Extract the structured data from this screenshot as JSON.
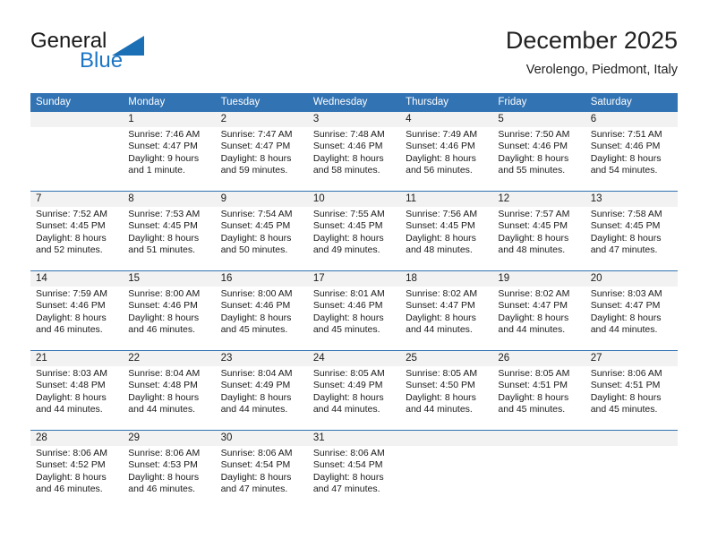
{
  "brand": {
    "word1": "General",
    "word2": "Blue",
    "triangle_color": "#1a6fb5",
    "blue_text_color": "#1c76c5"
  },
  "header": {
    "month_title": "December 2025",
    "location": "Verolengo, Piedmont, Italy"
  },
  "theme": {
    "header_blue": "#3273b3",
    "day_band_gray": "#f2f2f2",
    "text_color": "#1a1a1a"
  },
  "calendar": {
    "weekdays": [
      "Sunday",
      "Monday",
      "Tuesday",
      "Wednesday",
      "Thursday",
      "Friday",
      "Saturday"
    ],
    "weeks": [
      [
        {
          "day": "",
          "lines": []
        },
        {
          "day": "1",
          "lines": [
            "Sunrise: 7:46 AM",
            "Sunset: 4:47 PM",
            "Daylight: 9 hours",
            "and 1 minute."
          ]
        },
        {
          "day": "2",
          "lines": [
            "Sunrise: 7:47 AM",
            "Sunset: 4:47 PM",
            "Daylight: 8 hours",
            "and 59 minutes."
          ]
        },
        {
          "day": "3",
          "lines": [
            "Sunrise: 7:48 AM",
            "Sunset: 4:46 PM",
            "Daylight: 8 hours",
            "and 58 minutes."
          ]
        },
        {
          "day": "4",
          "lines": [
            "Sunrise: 7:49 AM",
            "Sunset: 4:46 PM",
            "Daylight: 8 hours",
            "and 56 minutes."
          ]
        },
        {
          "day": "5",
          "lines": [
            "Sunrise: 7:50 AM",
            "Sunset: 4:46 PM",
            "Daylight: 8 hours",
            "and 55 minutes."
          ]
        },
        {
          "day": "6",
          "lines": [
            "Sunrise: 7:51 AM",
            "Sunset: 4:46 PM",
            "Daylight: 8 hours",
            "and 54 minutes."
          ]
        }
      ],
      [
        {
          "day": "7",
          "lines": [
            "Sunrise: 7:52 AM",
            "Sunset: 4:45 PM",
            "Daylight: 8 hours",
            "and 52 minutes."
          ]
        },
        {
          "day": "8",
          "lines": [
            "Sunrise: 7:53 AM",
            "Sunset: 4:45 PM",
            "Daylight: 8 hours",
            "and 51 minutes."
          ]
        },
        {
          "day": "9",
          "lines": [
            "Sunrise: 7:54 AM",
            "Sunset: 4:45 PM",
            "Daylight: 8 hours",
            "and 50 minutes."
          ]
        },
        {
          "day": "10",
          "lines": [
            "Sunrise: 7:55 AM",
            "Sunset: 4:45 PM",
            "Daylight: 8 hours",
            "and 49 minutes."
          ]
        },
        {
          "day": "11",
          "lines": [
            "Sunrise: 7:56 AM",
            "Sunset: 4:45 PM",
            "Daylight: 8 hours",
            "and 48 minutes."
          ]
        },
        {
          "day": "12",
          "lines": [
            "Sunrise: 7:57 AM",
            "Sunset: 4:45 PM",
            "Daylight: 8 hours",
            "and 48 minutes."
          ]
        },
        {
          "day": "13",
          "lines": [
            "Sunrise: 7:58 AM",
            "Sunset: 4:45 PM",
            "Daylight: 8 hours",
            "and 47 minutes."
          ]
        }
      ],
      [
        {
          "day": "14",
          "lines": [
            "Sunrise: 7:59 AM",
            "Sunset: 4:46 PM",
            "Daylight: 8 hours",
            "and 46 minutes."
          ]
        },
        {
          "day": "15",
          "lines": [
            "Sunrise: 8:00 AM",
            "Sunset: 4:46 PM",
            "Daylight: 8 hours",
            "and 46 minutes."
          ]
        },
        {
          "day": "16",
          "lines": [
            "Sunrise: 8:00 AM",
            "Sunset: 4:46 PM",
            "Daylight: 8 hours",
            "and 45 minutes."
          ]
        },
        {
          "day": "17",
          "lines": [
            "Sunrise: 8:01 AM",
            "Sunset: 4:46 PM",
            "Daylight: 8 hours",
            "and 45 minutes."
          ]
        },
        {
          "day": "18",
          "lines": [
            "Sunrise: 8:02 AM",
            "Sunset: 4:47 PM",
            "Daylight: 8 hours",
            "and 44 minutes."
          ]
        },
        {
          "day": "19",
          "lines": [
            "Sunrise: 8:02 AM",
            "Sunset: 4:47 PM",
            "Daylight: 8 hours",
            "and 44 minutes."
          ]
        },
        {
          "day": "20",
          "lines": [
            "Sunrise: 8:03 AM",
            "Sunset: 4:47 PM",
            "Daylight: 8 hours",
            "and 44 minutes."
          ]
        }
      ],
      [
        {
          "day": "21",
          "lines": [
            "Sunrise: 8:03 AM",
            "Sunset: 4:48 PM",
            "Daylight: 8 hours",
            "and 44 minutes."
          ]
        },
        {
          "day": "22",
          "lines": [
            "Sunrise: 8:04 AM",
            "Sunset: 4:48 PM",
            "Daylight: 8 hours",
            "and 44 minutes."
          ]
        },
        {
          "day": "23",
          "lines": [
            "Sunrise: 8:04 AM",
            "Sunset: 4:49 PM",
            "Daylight: 8 hours",
            "and 44 minutes."
          ]
        },
        {
          "day": "24",
          "lines": [
            "Sunrise: 8:05 AM",
            "Sunset: 4:49 PM",
            "Daylight: 8 hours",
            "and 44 minutes."
          ]
        },
        {
          "day": "25",
          "lines": [
            "Sunrise: 8:05 AM",
            "Sunset: 4:50 PM",
            "Daylight: 8 hours",
            "and 44 minutes."
          ]
        },
        {
          "day": "26",
          "lines": [
            "Sunrise: 8:05 AM",
            "Sunset: 4:51 PM",
            "Daylight: 8 hours",
            "and 45 minutes."
          ]
        },
        {
          "day": "27",
          "lines": [
            "Sunrise: 8:06 AM",
            "Sunset: 4:51 PM",
            "Daylight: 8 hours",
            "and 45 minutes."
          ]
        }
      ],
      [
        {
          "day": "28",
          "lines": [
            "Sunrise: 8:06 AM",
            "Sunset: 4:52 PM",
            "Daylight: 8 hours",
            "and 46 minutes."
          ]
        },
        {
          "day": "29",
          "lines": [
            "Sunrise: 8:06 AM",
            "Sunset: 4:53 PM",
            "Daylight: 8 hours",
            "and 46 minutes."
          ]
        },
        {
          "day": "30",
          "lines": [
            "Sunrise: 8:06 AM",
            "Sunset: 4:54 PM",
            "Daylight: 8 hours",
            "and 47 minutes."
          ]
        },
        {
          "day": "31",
          "lines": [
            "Sunrise: 8:06 AM",
            "Sunset: 4:54 PM",
            "Daylight: 8 hours",
            "and 47 minutes."
          ]
        },
        {
          "day": "",
          "lines": []
        },
        {
          "day": "",
          "lines": []
        },
        {
          "day": "",
          "lines": []
        }
      ]
    ]
  }
}
